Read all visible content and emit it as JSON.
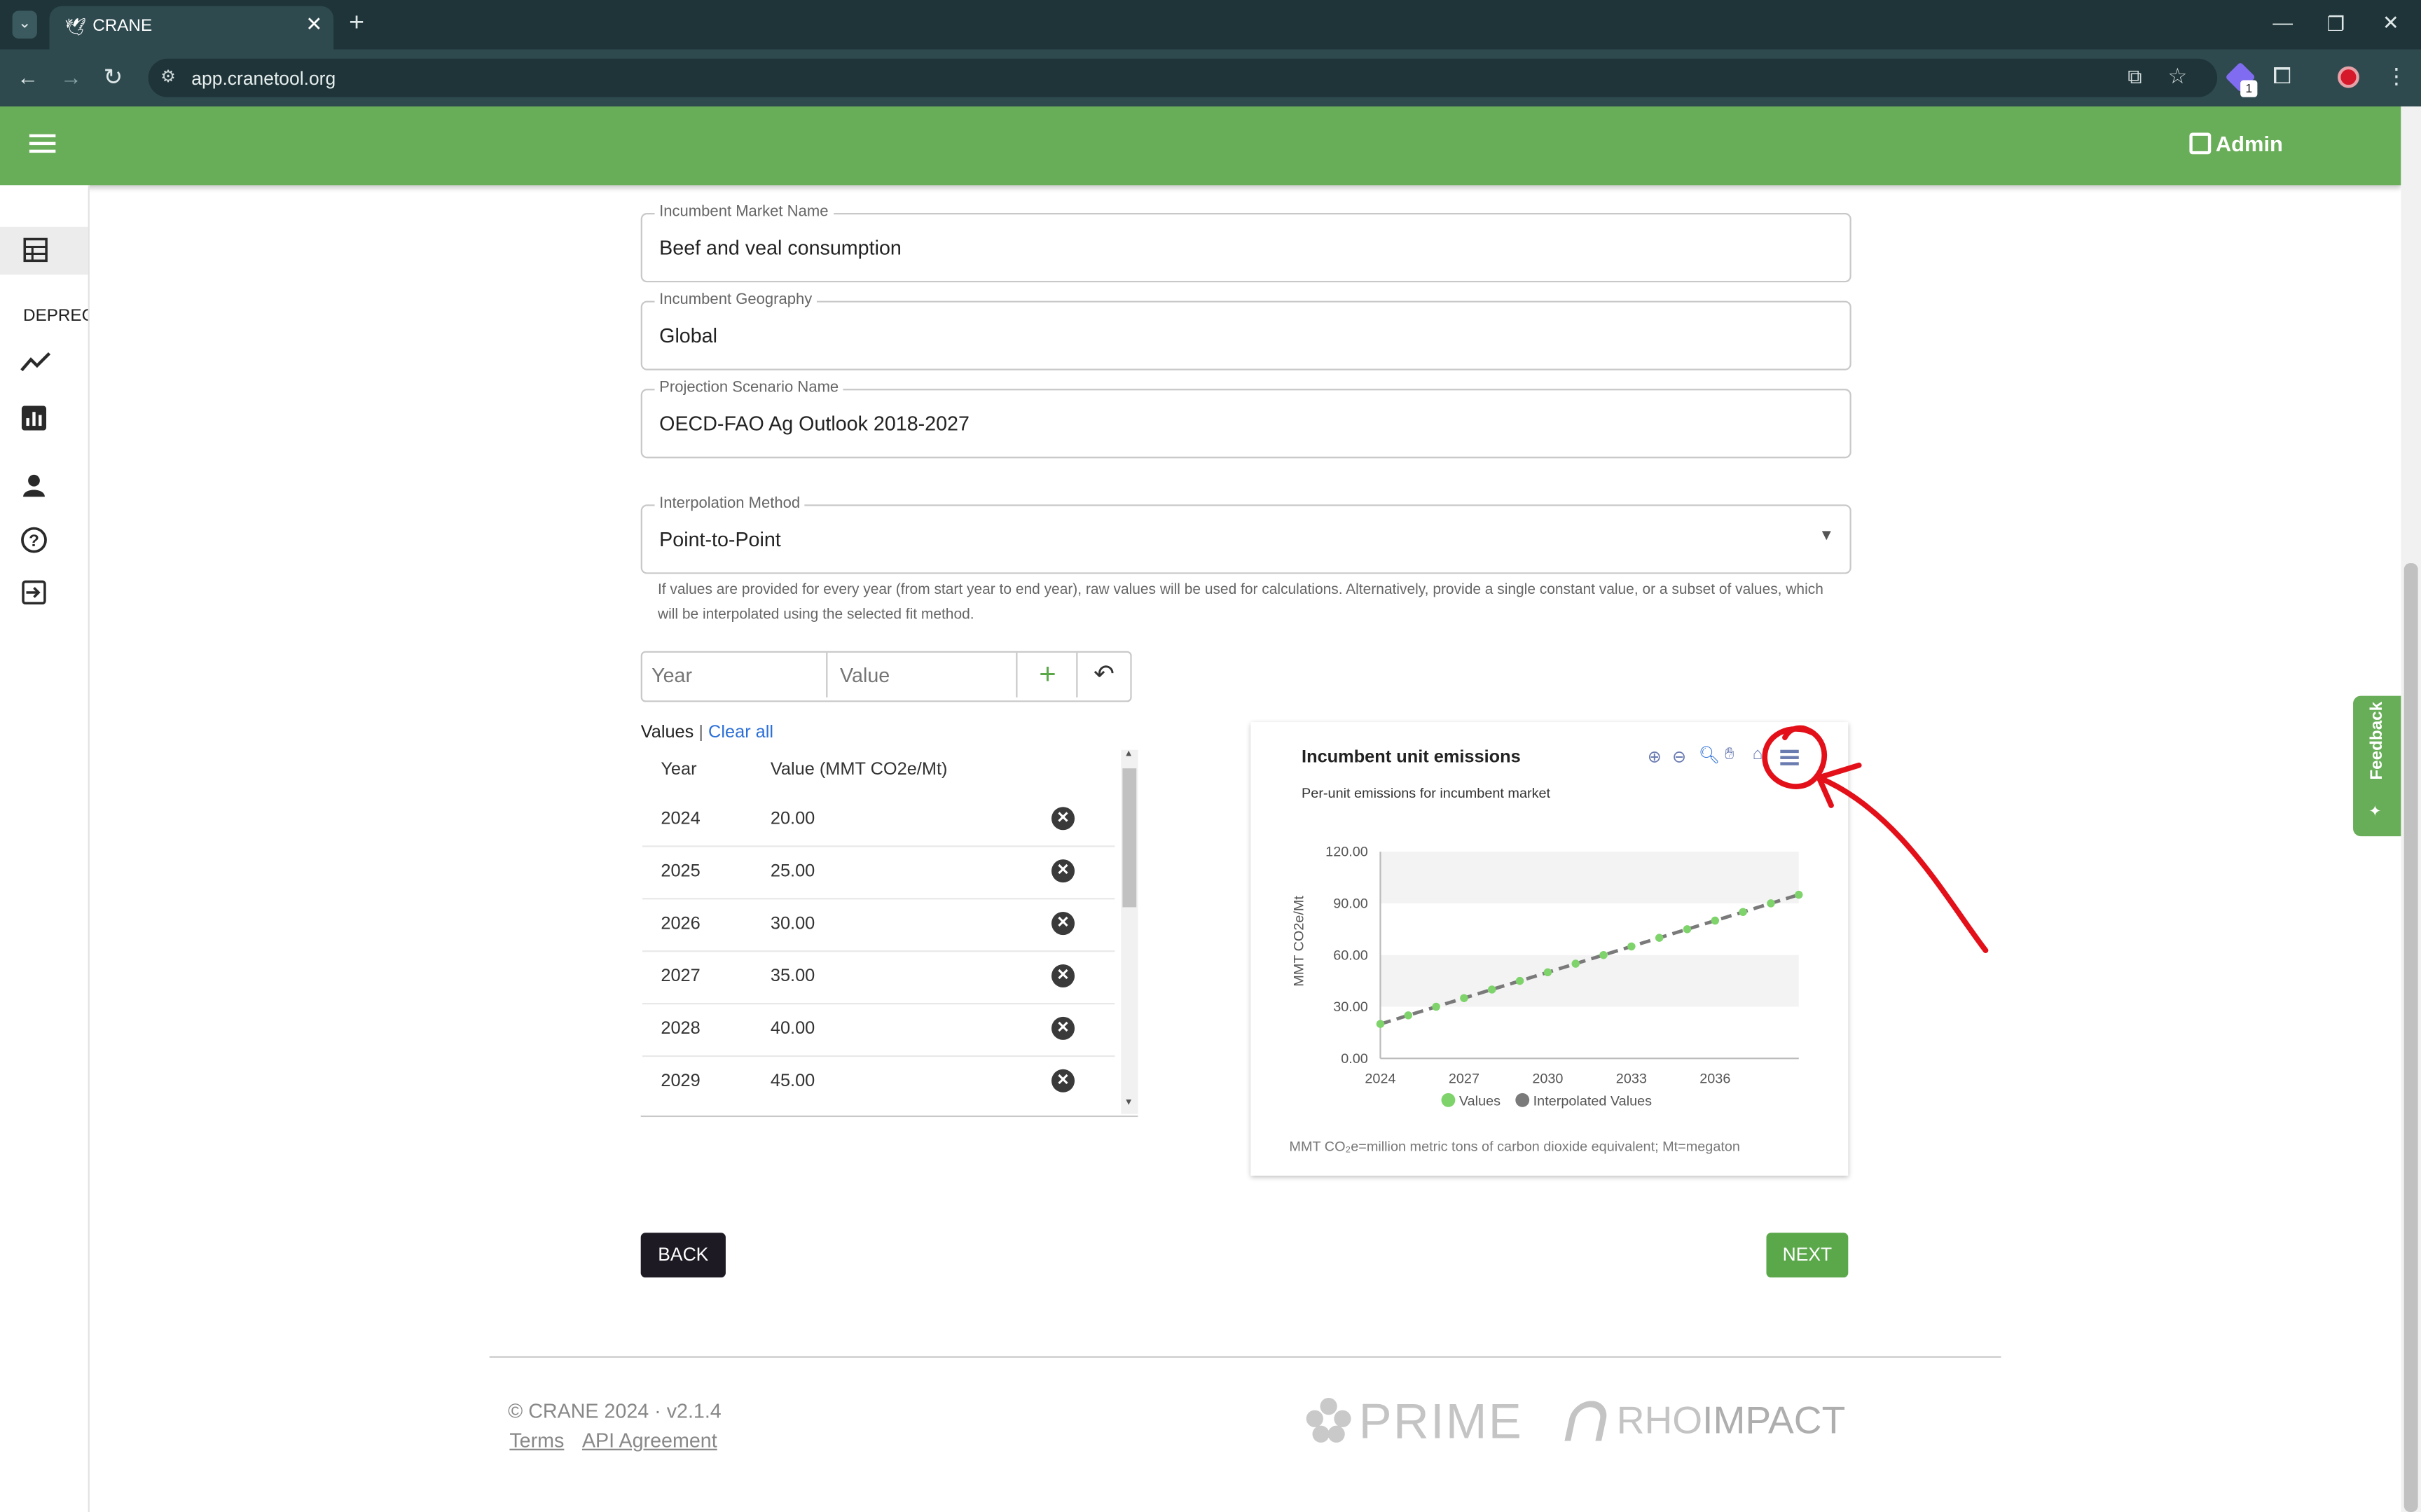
{
  "browser": {
    "tab_title": "CRANE",
    "url": "app.cranetool.org",
    "extension_badge": "1"
  },
  "header": {
    "admin_label": "Admin"
  },
  "sidebar": {
    "deprecated_label": "DEPRECA"
  },
  "form": {
    "incumbent_market": {
      "label": "Incumbent Market Name",
      "value": "Beef and veal consumption"
    },
    "incumbent_geography": {
      "label": "Incumbent Geography",
      "value": "Global"
    },
    "projection_scenario": {
      "label": "Projection Scenario Name",
      "value": "OECD-FAO Ag Outlook 2018-2027"
    },
    "interpolation_method": {
      "label": "Interpolation Method",
      "value": "Point-to-Point"
    },
    "help_text": "If values are provided for every year (from start year to end year), raw values will be used for calculations. Alternatively, provide a single constant value, or a subset of values, which will be interpolated using the selected fit method.",
    "year_placeholder": "Year",
    "value_placeholder": "Value"
  },
  "values_table": {
    "title": "Values",
    "separator": "|",
    "clear_all": "Clear all",
    "col_year": "Year",
    "col_value": "Value (MMT CO2e/Mt)",
    "rows": [
      {
        "year": "2024",
        "value": "20.00"
      },
      {
        "year": "2025",
        "value": "25.00"
      },
      {
        "year": "2026",
        "value": "30.00"
      },
      {
        "year": "2027",
        "value": "35.00"
      },
      {
        "year": "2028",
        "value": "40.00"
      },
      {
        "year": "2029",
        "value": "45.00"
      }
    ]
  },
  "chart_data": {
    "type": "line",
    "title": "Incumbent unit emissions",
    "subtitle": "Per-unit emissions for incumbent market",
    "ylabel": "MMT CO2e/Mt",
    "xlabel": "",
    "ylim": [
      0,
      120
    ],
    "yticks": [
      "120.00",
      "90.00",
      "60.00",
      "30.00",
      "0.00"
    ],
    "xticks": [
      "2024",
      "2027",
      "2030",
      "2033",
      "2036"
    ],
    "x": [
      2024,
      2025,
      2026,
      2027,
      2028,
      2029,
      2030,
      2031,
      2032,
      2033,
      2034,
      2035,
      2036,
      2037,
      2038,
      2039
    ],
    "series": [
      {
        "name": "Values",
        "color": "#7ed36b",
        "values": [
          20,
          25,
          30,
          35,
          40,
          45,
          50,
          55,
          60,
          65,
          70,
          75,
          80,
          85,
          90,
          95
        ]
      },
      {
        "name": "Interpolated Values",
        "color": "#7a7a7a",
        "values": [
          20,
          25,
          30,
          35,
          40,
          45,
          50,
          55,
          60,
          65,
          70,
          75,
          80,
          85,
          90,
          95
        ]
      }
    ],
    "legend": "bottom",
    "footnote": "MMT CO₂e=million metric tons of carbon dioxide equivalent; Mt=megaton"
  },
  "buttons": {
    "back": "BACK",
    "next": "NEXT"
  },
  "feedback": {
    "label": "Feedback"
  },
  "footer": {
    "copyright": "© CRANE 2024 · v2.1.4",
    "terms": "Terms",
    "api": "API Agreement",
    "logo_prime": "PRIME",
    "logo_rho": "RHO",
    "logo_impact": "IMPACT"
  },
  "colors": {
    "brand_green": "#68ad57",
    "annotation_red": "#e3101a",
    "link_blue": "#2b6fd6"
  }
}
